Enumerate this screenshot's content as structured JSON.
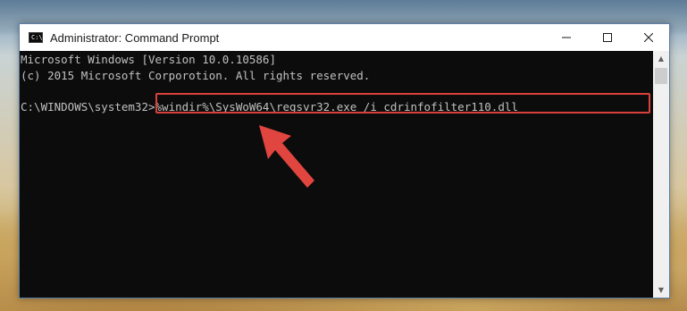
{
  "window": {
    "title": "Administrator: Command Prompt",
    "icon_label": "C:\\",
    "controls": {
      "minimize_icon": "minimize-icon",
      "maximize_icon": "maximize-icon",
      "close_icon": "close-icon"
    }
  },
  "console": {
    "lines": [
      "Microsoft Windows [Version 10.0.10586]",
      "(c) 2015 Microsoft Corporotion. All rights reserved."
    ],
    "prompt": "C:\\WINDOWS\\system32>",
    "command": "%windir%\\SysWoW64\\regsvr32.exe /i cdrinfofilter110.dll"
  },
  "annotation": {
    "highlight_color": "#d9413d",
    "arrow_color": "#e0463f"
  }
}
